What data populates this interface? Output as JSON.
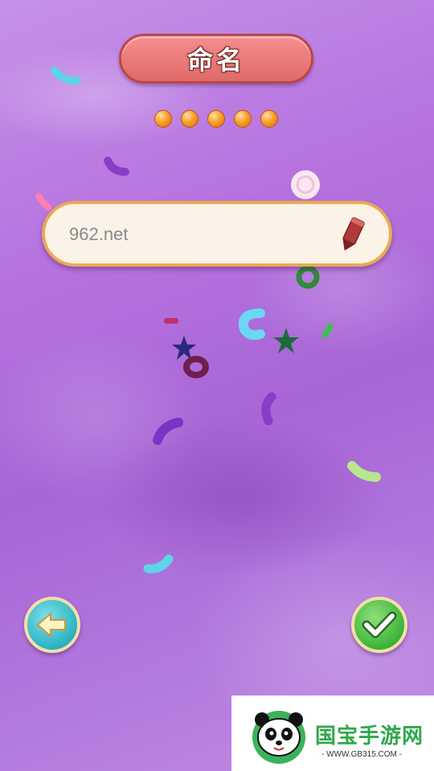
{
  "header": {
    "title": "命名"
  },
  "progress": {
    "total": 5,
    "filled": 5
  },
  "name_field": {
    "value": "962.net",
    "icon": "pencil-icon"
  },
  "buttons": {
    "back_icon": "arrow-left-icon",
    "confirm_icon": "checkmark-icon"
  },
  "watermark": {
    "brand": "国宝手游网",
    "url": "- WWW.GB315.COM -"
  },
  "colors": {
    "title_pill": "#e06a6a",
    "input_border": "#e9a85a",
    "back_button": "#2bb2c2",
    "confirm_button": "#3cb43a",
    "background": "#b673df"
  }
}
